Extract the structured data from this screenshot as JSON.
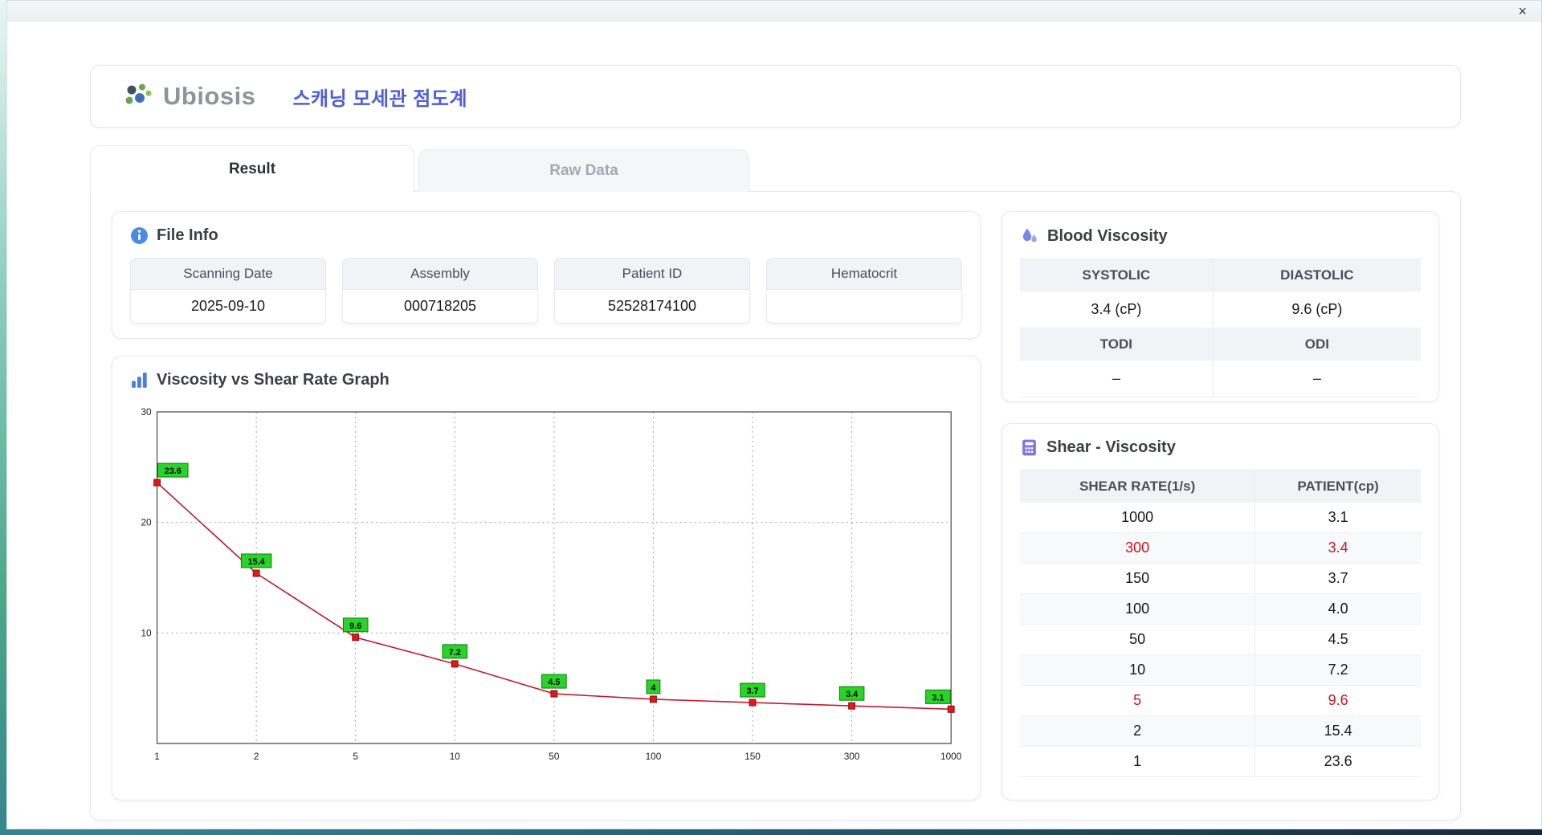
{
  "window": {
    "close_label": "×"
  },
  "header": {
    "logo_text": "Ubiosis",
    "title": "스캐닝 모세관 점도계"
  },
  "tabs": [
    {
      "label": "Result",
      "active": true
    },
    {
      "label": "Raw Data",
      "active": false
    }
  ],
  "file_info": {
    "title": "File Info",
    "fields": [
      {
        "label": "Scanning Date",
        "value": "2025-09-10"
      },
      {
        "label": "Assembly",
        "value": "000718205"
      },
      {
        "label": "Patient ID",
        "value": "52528174100"
      },
      {
        "label": "Hematocrit",
        "value": ""
      }
    ]
  },
  "blood_viscosity": {
    "title": "Blood Viscosity",
    "rows": [
      {
        "labels": [
          "SYSTOLIC",
          "DIASTOLIC"
        ],
        "values": [
          "3.4 (cP)",
          "9.6 (cP)"
        ]
      },
      {
        "labels": [
          "TODI",
          "ODI"
        ],
        "values": [
          "–",
          "–"
        ]
      }
    ]
  },
  "chart_data": {
    "type": "line",
    "title": "Viscosity vs Shear Rate Graph",
    "xlabel": "",
    "ylabel": "",
    "x_labels": [
      "1",
      "2",
      "5",
      "10",
      "50",
      "100",
      "150",
      "300",
      "1000"
    ],
    "x": [
      1,
      2,
      5,
      10,
      50,
      100,
      150,
      300,
      1000
    ],
    "y": [
      23.6,
      15.4,
      9.6,
      7.2,
      4.5,
      4,
      3.7,
      3.4,
      3.1
    ],
    "point_labels": [
      "23.6",
      "15.4",
      "9.6",
      "7.2",
      "4.5",
      "4",
      "3.7",
      "3.4",
      "3.1"
    ],
    "y_ticks": [
      10,
      20,
      30
    ],
    "ylim": [
      0,
      30
    ],
    "x_spacing": "categorical",
    "grid": true,
    "legend": false,
    "line_color": "#c21830",
    "marker_color": "#e01818",
    "marker_stroke": "#8a0f0f",
    "label_bg": "#27d427",
    "label_border": "#0f7a0f"
  },
  "shear_table": {
    "title": "Shear - Viscosity",
    "columns": [
      "SHEAR RATE(1/s)",
      "PATIENT(cp)"
    ],
    "rows": [
      {
        "shear": "1000",
        "patient": "3.1",
        "highlight": false
      },
      {
        "shear": "300",
        "patient": "3.4",
        "highlight": true
      },
      {
        "shear": "150",
        "patient": "3.7",
        "highlight": false
      },
      {
        "shear": "100",
        "patient": "4.0",
        "highlight": false
      },
      {
        "shear": "50",
        "patient": "4.5",
        "highlight": false
      },
      {
        "shear": "10",
        "patient": "7.2",
        "highlight": false
      },
      {
        "shear": "5",
        "patient": "9.6",
        "highlight": true
      },
      {
        "shear": "2",
        "patient": "15.4",
        "highlight": false
      },
      {
        "shear": "1",
        "patient": "23.6",
        "highlight": false
      }
    ]
  }
}
